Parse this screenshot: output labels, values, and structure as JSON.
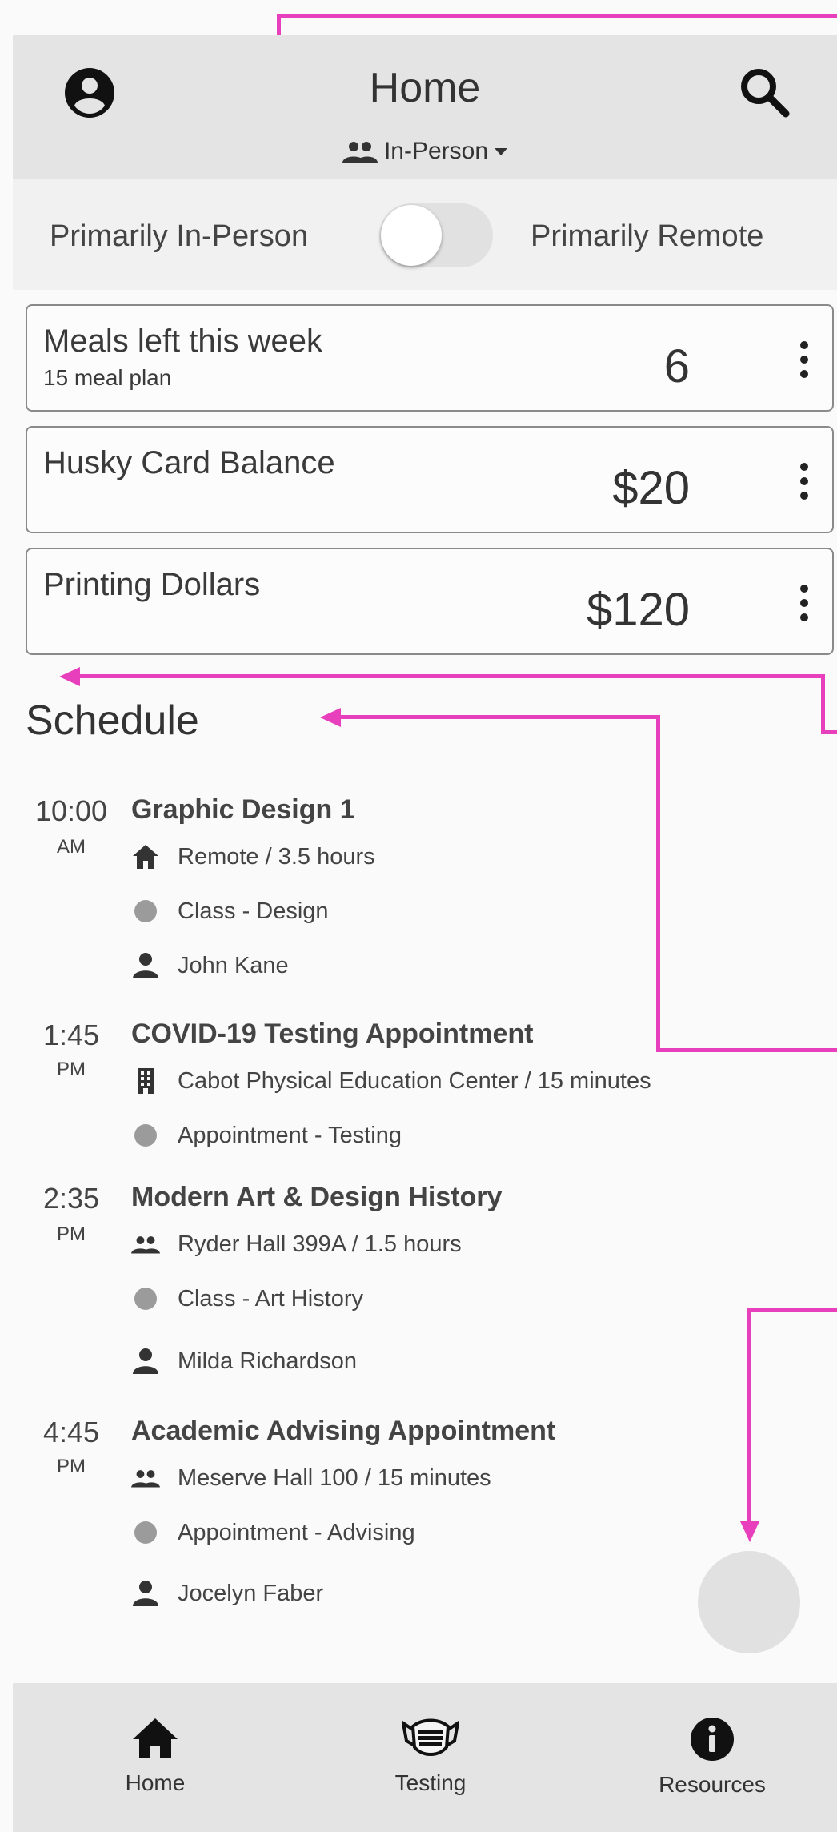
{
  "header": {
    "title": "Home",
    "mode_selector": "In-Person"
  },
  "mode_toggle": {
    "left_label": "Primarily In-Person",
    "right_label": "Primarily Remote",
    "is_remote": false
  },
  "cards": [
    {
      "label": "Meals left this week",
      "sublabel": "15 meal plan",
      "value": "6"
    },
    {
      "label": "Husky Card Balance",
      "sublabel": "",
      "value": "$20"
    },
    {
      "label": "Printing Dollars",
      "sublabel": "",
      "value": "$120"
    }
  ],
  "schedule": {
    "title": "Schedule",
    "events": [
      {
        "time": "10:00",
        "ampm": "AM",
        "title": "Graphic Design 1",
        "location": "Remote / 3.5 hours",
        "category": "Class - Design",
        "person": "John Kane"
      },
      {
        "time": "1:45",
        "ampm": "PM",
        "title": "COVID-19 Testing Appointment",
        "location": "Cabot Physical Education Center / 15 minutes",
        "category": "Appointment - Testing",
        "person": ""
      },
      {
        "time": "2:35",
        "ampm": "PM",
        "title": "Modern Art & Design History",
        "location": "Ryder Hall 399A / 1.5 hours",
        "category": "Class - Art History",
        "person": "Milda Richardson"
      },
      {
        "time": "4:45",
        "ampm": "PM",
        "title": "Academic Advising Appointment",
        "location": "Meserve Hall 100 / 15 minutes",
        "category": "Appointment - Advising",
        "person": "Jocelyn Faber"
      }
    ]
  },
  "bottom_nav": {
    "items": [
      {
        "label": "Home",
        "icon": "home-icon"
      },
      {
        "label": "Testing",
        "icon": "mask-icon"
      },
      {
        "label": "Resources",
        "icon": "info-icon"
      }
    ]
  },
  "colors": {
    "annotation": "#e83fbd",
    "bar_background": "#e4e4e4"
  }
}
